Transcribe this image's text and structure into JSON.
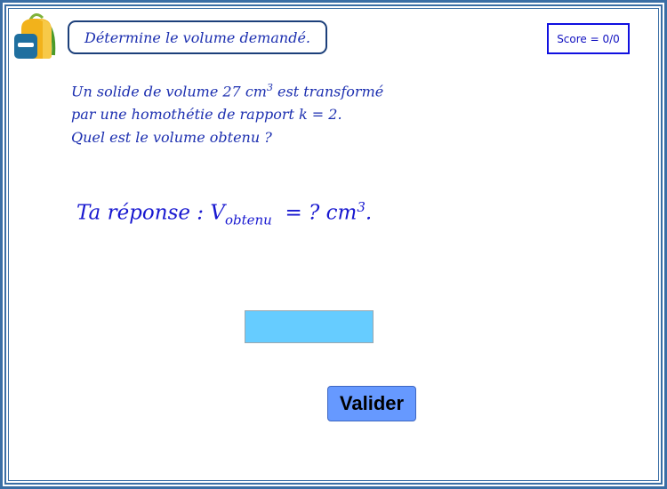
{
  "header": {
    "instruction": "Détermine le volume demandé.",
    "score": "Score = 0/0"
  },
  "problem": {
    "line1_before": "Un solide de volume 27 cm",
    "line1_sup": "3",
    "line1_after": " est transformé",
    "line2": "par une homothétie de rapport k =  2.",
    "line3": "Quel est le volume obtenu ?"
  },
  "answer": {
    "prefix": "Ta réponse : V",
    "subscript": "obtenu",
    "middle": "  = ? cm",
    "sup": "3",
    "suffix": ".",
    "input_value": ""
  },
  "actions": {
    "validate_label": "Valider"
  },
  "colors": {
    "frame": "#3a6ea5",
    "text_blue": "#1c2fb0",
    "input_bg": "#66ccff",
    "button_bg": "#6699ff"
  },
  "icons": {
    "logo": "backpack-icon"
  }
}
